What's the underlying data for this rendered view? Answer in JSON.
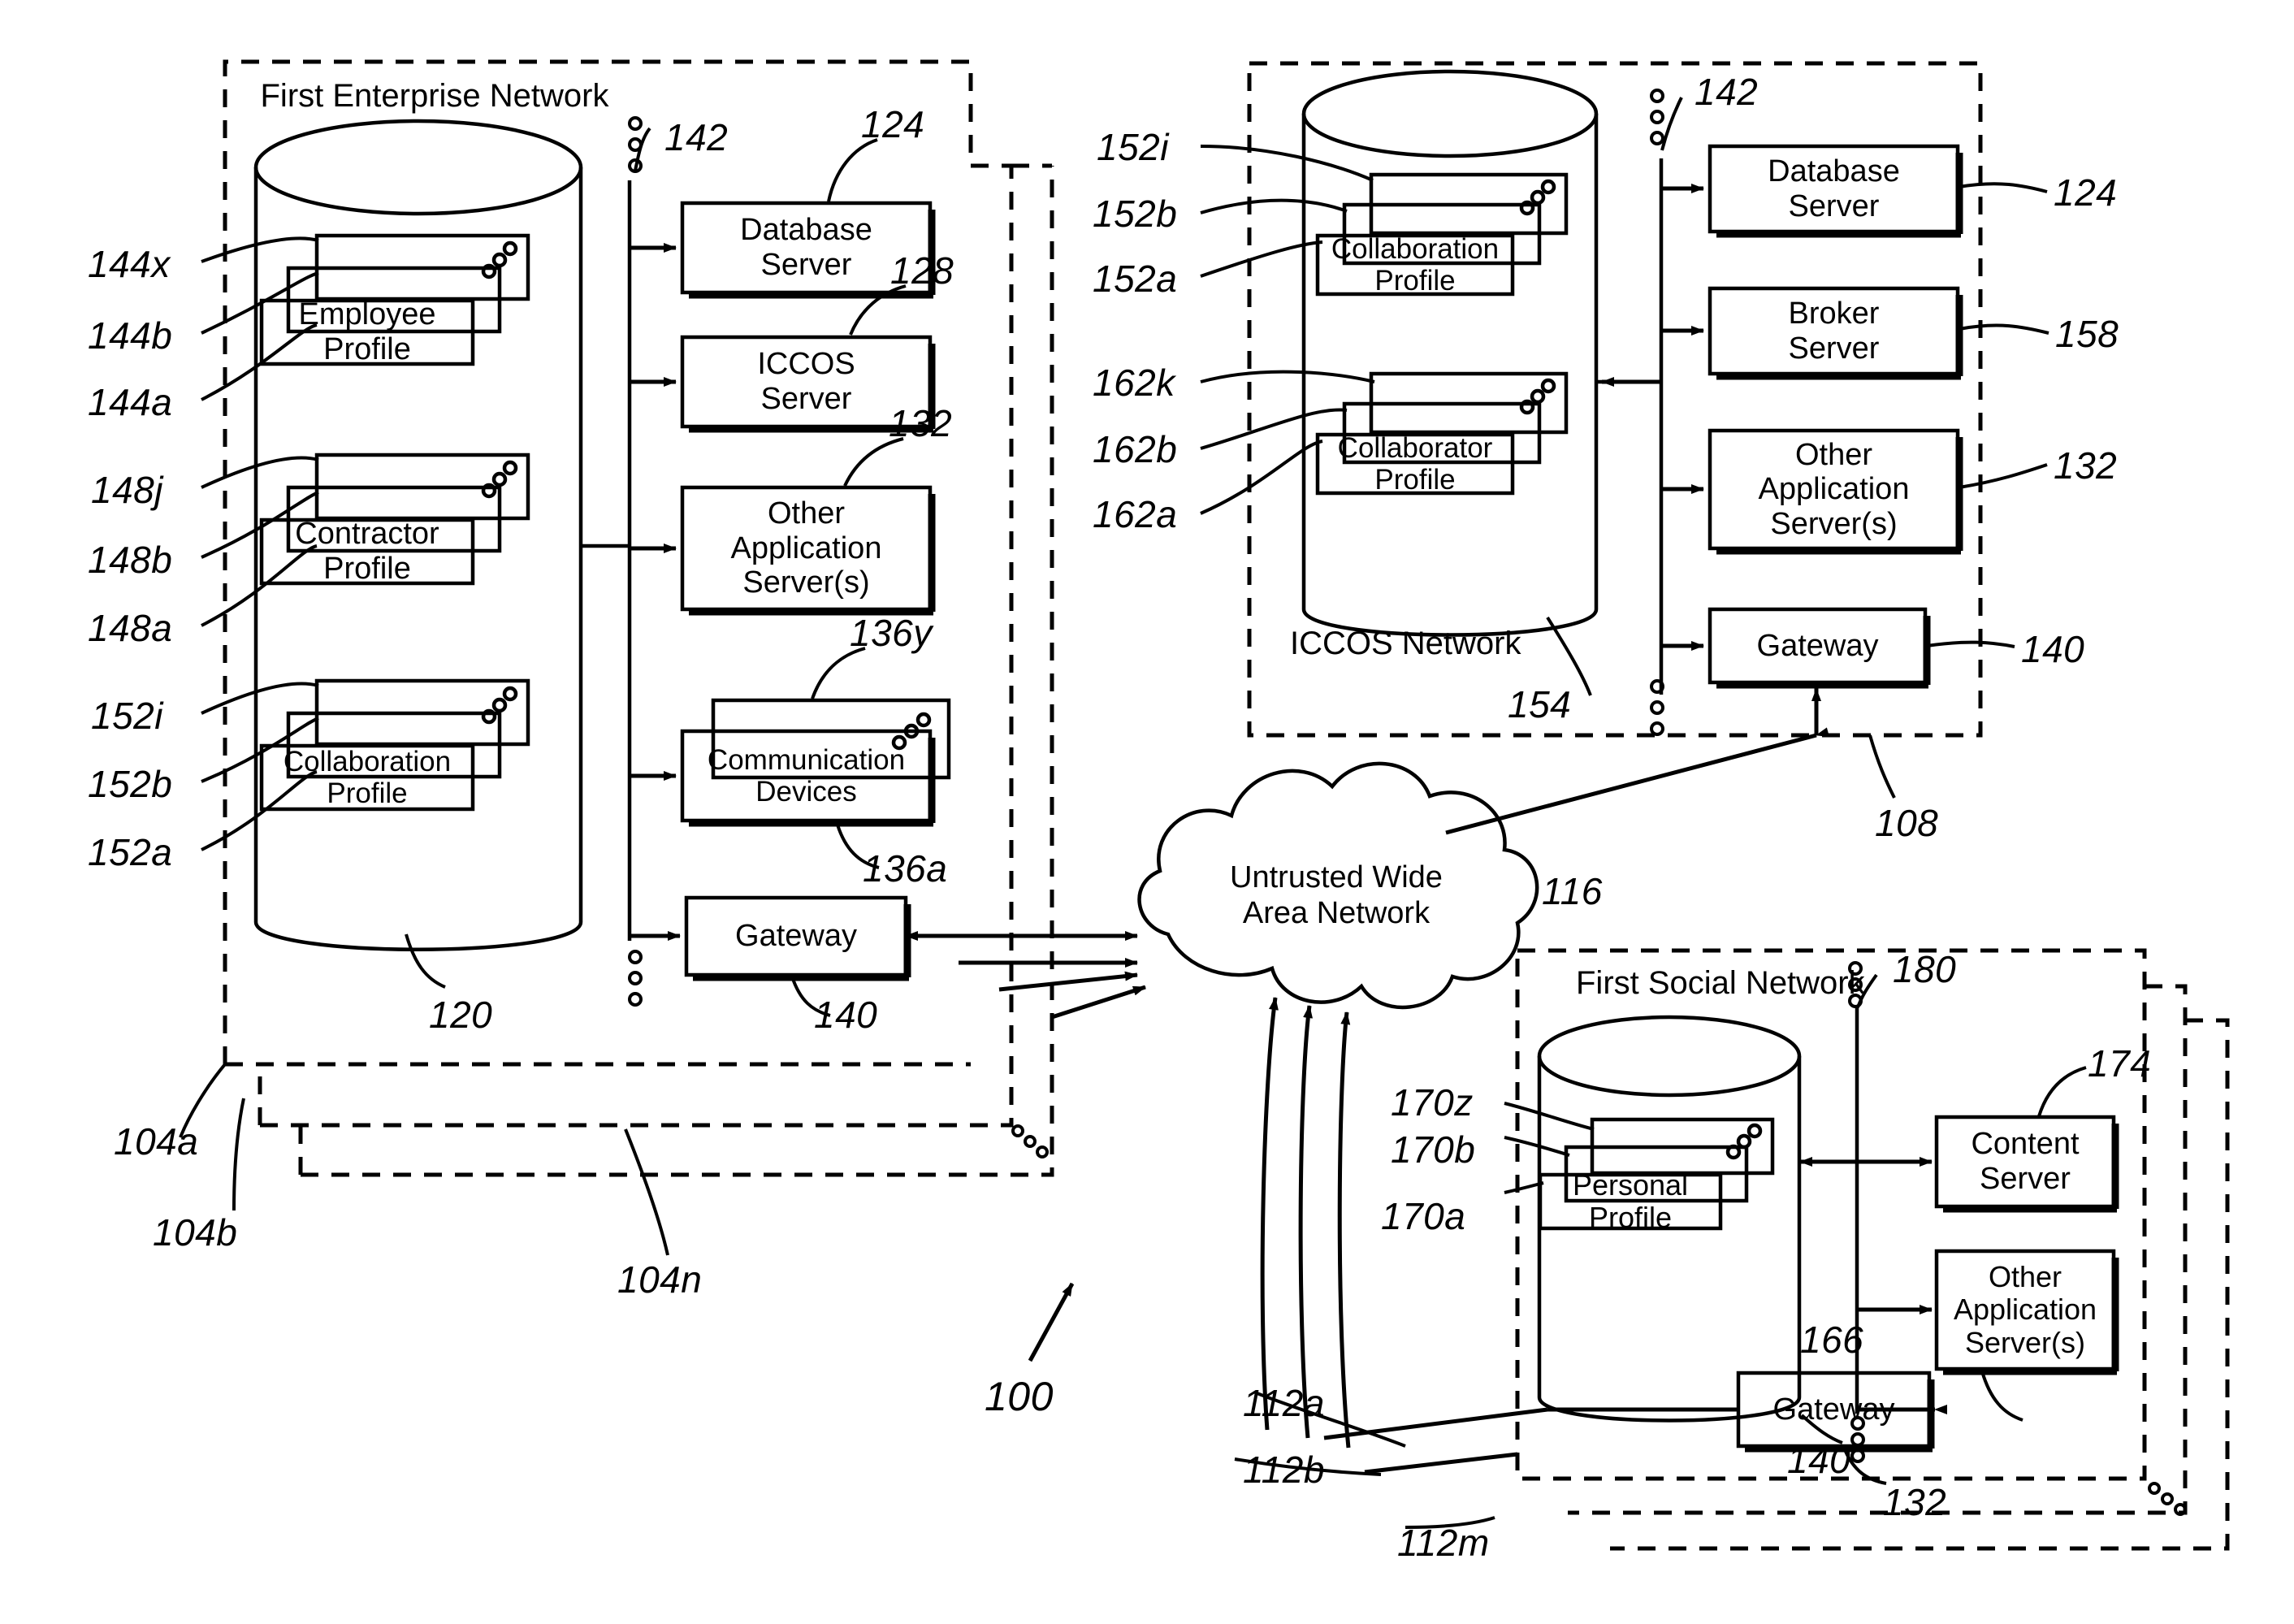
{
  "figure": {
    "kind": "patent-network-diagram",
    "overall_ref": "100"
  },
  "enterprise_network": {
    "title": "First Enterprise Network",
    "db_ref": "120",
    "bus_ref": "142",
    "outer_refs": [
      "104a",
      "104b",
      "104n"
    ],
    "profiles": [
      {
        "label": "Employee\nProfile",
        "refs": [
          "144x",
          "144b",
          "144a"
        ]
      },
      {
        "label": "Contractor\nProfile",
        "refs": [
          "148j",
          "148b",
          "148a"
        ]
      },
      {
        "label": "Collaboration\nProfile",
        "refs": [
          "152i",
          "152b",
          "152a"
        ]
      }
    ],
    "servers": [
      {
        "label": "Database\nServer",
        "ref": "124"
      },
      {
        "label": "ICCOS\nServer",
        "ref": "128"
      },
      {
        "label": "Other\nApplication\nServer(s)",
        "ref": "132"
      },
      {
        "label": "Communication\nDevices",
        "ref_top": "136y",
        "ref_bottom": "136a"
      },
      {
        "label": "Gateway",
        "ref": "140"
      }
    ]
  },
  "iccos_network": {
    "title": "ICCOS\nNetwork",
    "db_ref": "154",
    "bus_ref": "142",
    "outer_ref": "108",
    "profiles": [
      {
        "label": "Collaboration\nProfile",
        "refs": [
          "152i",
          "152b",
          "152a"
        ]
      },
      {
        "label": "Collaborator\nProfile",
        "refs": [
          "162k",
          "162b",
          "162a"
        ]
      }
    ],
    "servers": [
      {
        "label": "Database\nServer",
        "ref": "124"
      },
      {
        "label": "Broker\nServer",
        "ref": "158"
      },
      {
        "label": "Other\nApplication\nServer(s)",
        "ref": "132"
      },
      {
        "label": "Gateway",
        "ref": "140"
      }
    ]
  },
  "wan": {
    "label": "Untrusted Wide\nArea Network",
    "ref": "116"
  },
  "social_network": {
    "title": "First Social\nNetwork",
    "db_ref": "166",
    "bus_ref": "180",
    "outer_refs": [
      "112a",
      "112b",
      "112m"
    ],
    "profiles": [
      {
        "label": "Personal\nProfile",
        "refs": [
          "170z",
          "170b",
          "170a"
        ]
      }
    ],
    "servers": [
      {
        "label": "Content\nServer",
        "ref": "174"
      },
      {
        "label": "Other\nApplication\nServer(s)",
        "ref": "132"
      },
      {
        "label": "Gateway",
        "ref": "140"
      }
    ]
  },
  "reference_numerals": {
    "r100": "100",
    "r104a": "104a",
    "r104b": "104b",
    "r104n": "104n",
    "r108": "108",
    "r112a": "112a",
    "r112b": "112b",
    "r112m": "112m",
    "r116": "116",
    "r120": "120",
    "r124": "124",
    "r128": "128",
    "r132": "132",
    "r136a": "136a",
    "r136y": "136y",
    "r140": "140",
    "r142": "142",
    "r144a": "144a",
    "r144b": "144b",
    "r144x": "144x",
    "r148a": "148a",
    "r148b": "148b",
    "r148j": "148j",
    "r152a": "152a",
    "r152b": "152b",
    "r152i": "152i",
    "r154": "154",
    "r158": "158",
    "r162a": "162a",
    "r162b": "162b",
    "r162k": "162k",
    "r166": "166",
    "r170a": "170a",
    "r170b": "170b",
    "r170z": "170z",
    "r174": "174",
    "r180": "180"
  },
  "colors": {
    "ink": "#000000",
    "paper": "#ffffff"
  }
}
